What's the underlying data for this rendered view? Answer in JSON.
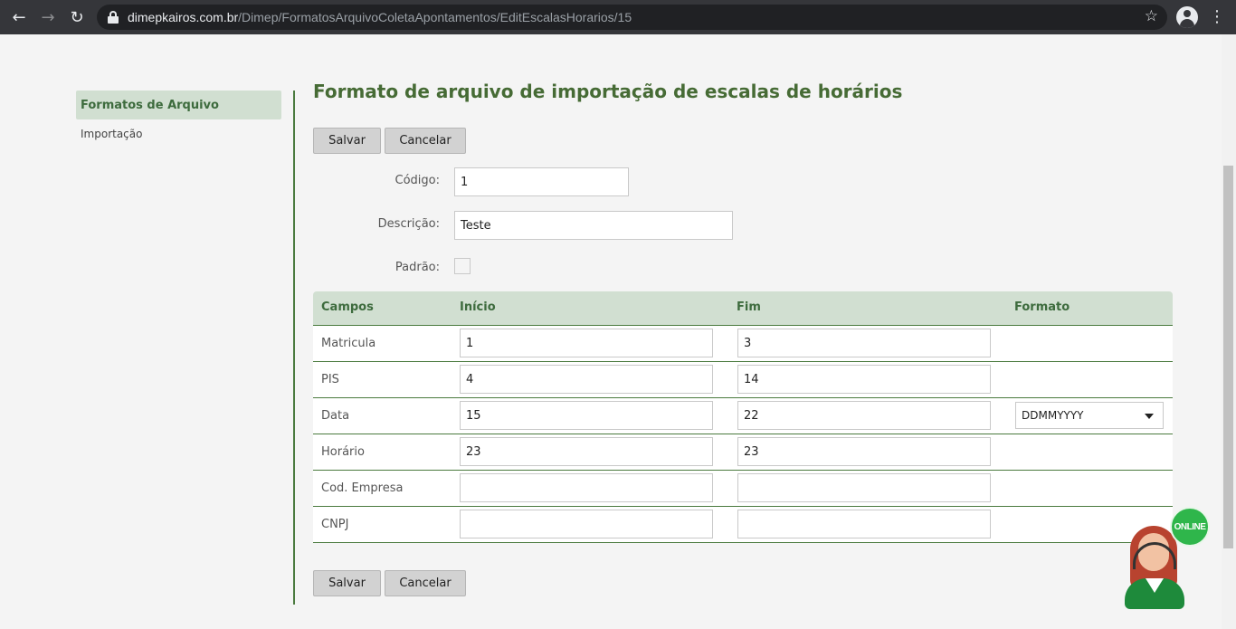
{
  "browser": {
    "url_host": "dimepkairos.com.br",
    "url_path": "/Dimep/FormatosArquivoColetaApontamentos/EditEscalasHorarios/15"
  },
  "sidebar": {
    "items": [
      {
        "label": "Formatos de Arquivo",
        "active": true
      },
      {
        "label": "Importação",
        "active": false
      }
    ]
  },
  "page": {
    "title": "Formato de arquivo de importação de escalas de horários"
  },
  "buttons": {
    "save": "Salvar",
    "cancel": "Cancelar"
  },
  "form": {
    "codigo_label": "Código:",
    "codigo_value": "1",
    "descricao_label": "Descrição:",
    "descricao_value": "Teste",
    "padrao_label": "Padrão:",
    "padrao_checked": false
  },
  "grid": {
    "headers": {
      "campos": "Campos",
      "inicio": "Início",
      "fim": "Fim",
      "formato": "Formato"
    },
    "rows": [
      {
        "campo": "Matricula",
        "inicio": "1",
        "fim": "3"
      },
      {
        "campo": "PIS",
        "inicio": "4",
        "fim": "14"
      },
      {
        "campo": "Data",
        "inicio": "15",
        "fim": "22",
        "formato": "DDMMYYYY"
      },
      {
        "campo": "Horário",
        "inicio": "23",
        "fim": "23"
      },
      {
        "campo": "Cod. Empresa",
        "inicio": "",
        "fim": ""
      },
      {
        "campo": "CNPJ",
        "inicio": "",
        "fim": ""
      }
    ]
  },
  "widget": {
    "badge": "ONLINE"
  },
  "colors": {
    "accent_green": "#466b35",
    "header_bg": "#d1dfd1",
    "online_green": "#2fb64b"
  }
}
